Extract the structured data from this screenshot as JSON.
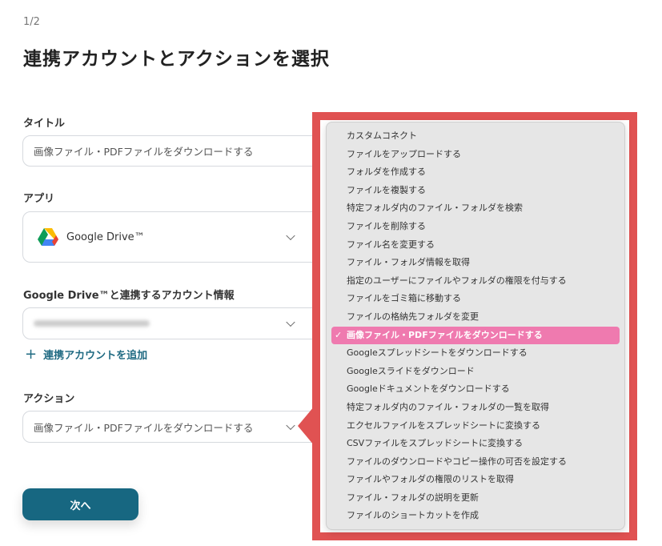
{
  "step": "1/2",
  "title": "連携アカウントとアクションを選択",
  "form": {
    "title_label": "タイトル",
    "title_value": "画像ファイル・PDFファイルをダウンロードする",
    "app_label": "アプリ",
    "app_value": "Google Drive™",
    "account_label": "Google Drive™と連携するアカウント情報",
    "add_account": "連携アカウントを追加",
    "action_label": "アクション",
    "action_value": "画像ファイル・PDFファイルをダウンロードする",
    "next_button": "次へ"
  },
  "menu": {
    "items": [
      "カスタムコネクト",
      "ファイルをアップロードする",
      "フォルダを作成する",
      "ファイルを複製する",
      "特定フォルダ内のファイル・フォルダを検索",
      "ファイルを削除する",
      "ファイル名を変更する",
      "ファイル・フォルダ情報を取得",
      "指定のユーザーにファイルやフォルダの権限を付与する",
      "ファイルをゴミ箱に移動する",
      "ファイルの格納先フォルダを変更",
      "画像ファイル・PDFファイルをダウンロードする",
      "Googleスプレッドシートをダウンロードする",
      "Googleスライドをダウンロード",
      "Googleドキュメントをダウンロードする",
      "特定フォルダ内のファイル・フォルダの一覧を取得",
      "エクセルファイルをスプレッドシートに変換する",
      "CSVファイルをスプレッドシートに変換する",
      "ファイルのダウンロードやコピー操作の可否を設定する",
      "ファイルやフォルダの権限のリストを取得",
      "ファイル・フォルダの説明を更新",
      "ファイルのショートカットを作成"
    ],
    "selected_index": 11,
    "check": "✓"
  },
  "colors": {
    "highlight": "#e05252",
    "selected": "#ef7aaf",
    "primary": "#176781"
  }
}
